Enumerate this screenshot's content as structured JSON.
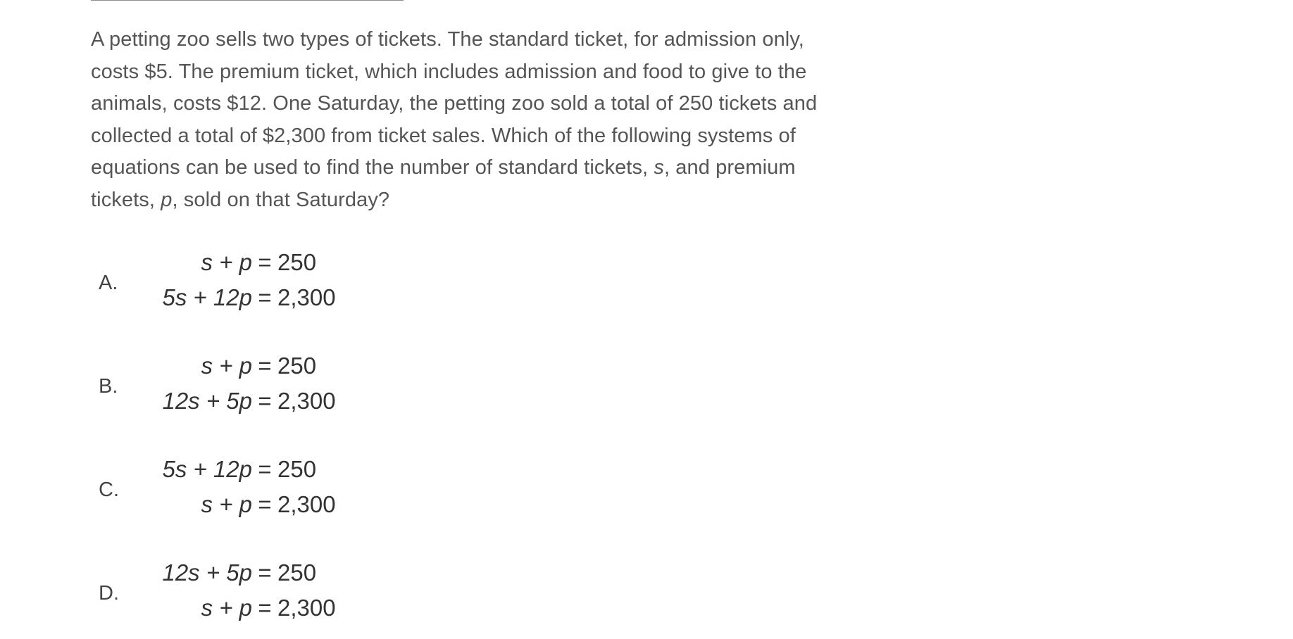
{
  "question": {
    "segments": [
      {
        "text": "A petting zoo sells two types of tickets. The standard ticket, for admission only, costs $5. The premium ticket, which includes admission and food to give to the animals, costs $12. One Saturday, the petting zoo sold a total of 250 tickets and collected a total of $2,300 from ticket sales. Which of the following systems of equations can be used to find the number of standard tickets, ",
        "italic": false
      },
      {
        "text": "s",
        "italic": true
      },
      {
        "text": ", and premium tickets, ",
        "italic": false
      },
      {
        "text": "p",
        "italic": true
      },
      {
        "text": ", sold on that Saturday?",
        "italic": false
      }
    ]
  },
  "choices": [
    {
      "letter": "A.",
      "line1": {
        "lhs": "s + p",
        "sign": "=",
        "rhs": "250"
      },
      "line2": {
        "lhs": "5s + 12p",
        "sign": "=",
        "rhs": "2,300"
      }
    },
    {
      "letter": "B.",
      "line1": {
        "lhs": "s + p",
        "sign": "=",
        "rhs": "250"
      },
      "line2": {
        "lhs": "12s + 5p",
        "sign": "=",
        "rhs": "2,300"
      }
    },
    {
      "letter": "C.",
      "line1": {
        "lhs": "5s + 12p",
        "sign": "=",
        "rhs": "250"
      },
      "line2": {
        "lhs": "s + p",
        "sign": "=",
        "rhs": "2,300"
      }
    },
    {
      "letter": "D.",
      "line1": {
        "lhs": "12s + 5p",
        "sign": "=",
        "rhs": "250"
      },
      "line2": {
        "lhs": "s + p",
        "sign": "=",
        "rhs": "2,300"
      }
    }
  ]
}
